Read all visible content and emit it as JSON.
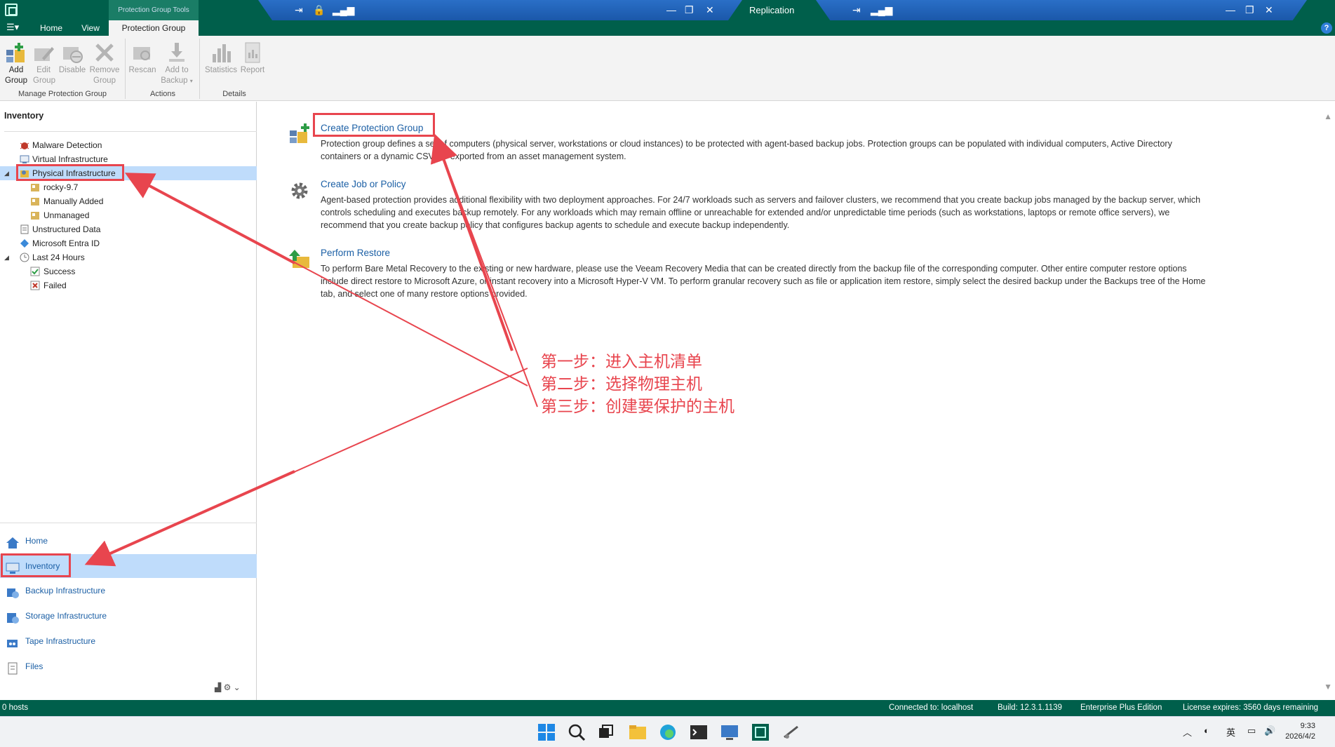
{
  "window": {
    "context_tab": "Protection Group Tools",
    "replication_label": "Replication"
  },
  "ribbon_tabs": [
    {
      "label": "Home"
    },
    {
      "label": "View"
    },
    {
      "label": "Protection Group",
      "active": true
    }
  ],
  "ribbon": {
    "buttons": [
      {
        "label": "Add Group",
        "enabled": true,
        "icon": "add-group-icon"
      },
      {
        "label": "Edit Group",
        "enabled": false,
        "icon": "edit-group-icon"
      },
      {
        "label": "Disable",
        "enabled": false,
        "icon": "disable-icon"
      },
      {
        "label": "Remove Group",
        "enabled": false,
        "icon": "remove-icon"
      },
      {
        "label": "Rescan",
        "enabled": false,
        "icon": "rescan-icon"
      },
      {
        "label": "Add to Backup",
        "enabled": false,
        "icon": "add-to-backup-icon"
      },
      {
        "label": "Statistics",
        "enabled": false,
        "icon": "statistics-icon"
      },
      {
        "label": "Report",
        "enabled": false,
        "icon": "report-icon"
      }
    ],
    "groups": {
      "manage": "Manage Protection Group",
      "actions": "Actions",
      "details": "Details"
    }
  },
  "inventory": {
    "title": "Inventory",
    "tree": [
      {
        "label": "Malware Detection",
        "icon": "malware-icon",
        "level": 0
      },
      {
        "label": "Virtual Infrastructure",
        "icon": "virtual-infrastructure-icon",
        "level": 0
      },
      {
        "label": "Physical Infrastructure",
        "icon": "physical-infrastructure-icon",
        "level": 0,
        "selected": true,
        "expanded": true
      },
      {
        "label": "rocky-9.7",
        "icon": "protection-group-icon",
        "level": 1
      },
      {
        "label": "Manually Added",
        "icon": "protection-group-icon",
        "level": 1
      },
      {
        "label": "Unmanaged",
        "icon": "protection-group-icon",
        "level": 1
      },
      {
        "label": "Unstructured Data",
        "icon": "unstructured-data-icon",
        "level": 0
      },
      {
        "label": "Microsoft Entra ID",
        "icon": "entra-id-icon",
        "level": 0
      },
      {
        "label": "Last 24 Hours",
        "icon": "clock-icon",
        "level": 0,
        "expanded": true
      },
      {
        "label": "Success",
        "icon": "success-icon",
        "level": 1
      },
      {
        "label": "Failed",
        "icon": "failed-icon",
        "level": 1
      }
    ]
  },
  "nav": [
    {
      "label": "Home",
      "icon": "home-icon"
    },
    {
      "label": "Inventory",
      "icon": "inventory-icon",
      "selected": true
    },
    {
      "label": "Backup Infrastructure",
      "icon": "backup-infrastructure-icon"
    },
    {
      "label": "Storage Infrastructure",
      "icon": "storage-infrastructure-icon"
    },
    {
      "label": "Tape Infrastructure",
      "icon": "tape-infrastructure-icon"
    },
    {
      "label": "Files",
      "icon": "files-icon"
    }
  ],
  "main": {
    "sections": [
      {
        "title": "Create Protection Group",
        "icon": "create-protection-group-icon",
        "body": "Protection group defines a set of computers (physical server, workstations or cloud instances) to be protected with agent-based backup jobs. Protection groups can be populated with individual computers, Active Directory containers or a dynamic CSV file exported from an asset management system."
      },
      {
        "title": "Create Job or Policy",
        "icon": "gear-icon",
        "body": "Agent-based protection provides additional flexibility with two deployment approaches. For 24/7 workloads such as servers and failover clusters, we recommend that you create backup jobs managed by the backup server, which controls scheduling and executes backup remotely. For any workloads which may remain offline or unreachable for extended and/or unpredictable time periods (such as workstations, laptops or remote office servers), we recommend that you create backup policy that configures backup agents to schedule and execute backup independently."
      },
      {
        "title": "Perform Restore",
        "icon": "restore-icon",
        "body": "To perform Bare Metal Recovery to the existing or new hardware, please use the Veeam Recovery Media that can be created directly from the backup file of the corresponding computer. Other entire computer restore options include direct restore to Microsoft Azure, or instant recovery into a Microsoft Hyper-V VM. To perform granular recovery such as file or application item restore, simply select the desired backup under the Backups tree of the Home tab, and select one of many restore options provided."
      }
    ]
  },
  "annotations": [
    "第一步：进入主机清单",
    "第二步：选择物理主机",
    "第三步：创建要保护的主机"
  ],
  "statusbar": {
    "hosts": "0 hosts",
    "connected": "Connected to: localhost",
    "build": "Build: 12.3.1.1139",
    "edition": "Enterprise Plus Edition",
    "license": "License expires: 3560 days remaining"
  },
  "taskbar": {
    "ime": "英",
    "time": "9:33",
    "date": "2026/4/2"
  },
  "colors": {
    "brand": "#005f4b",
    "link": "#1b5fa5",
    "selection": "#bfdcfb",
    "annotation": "#e8454e"
  }
}
